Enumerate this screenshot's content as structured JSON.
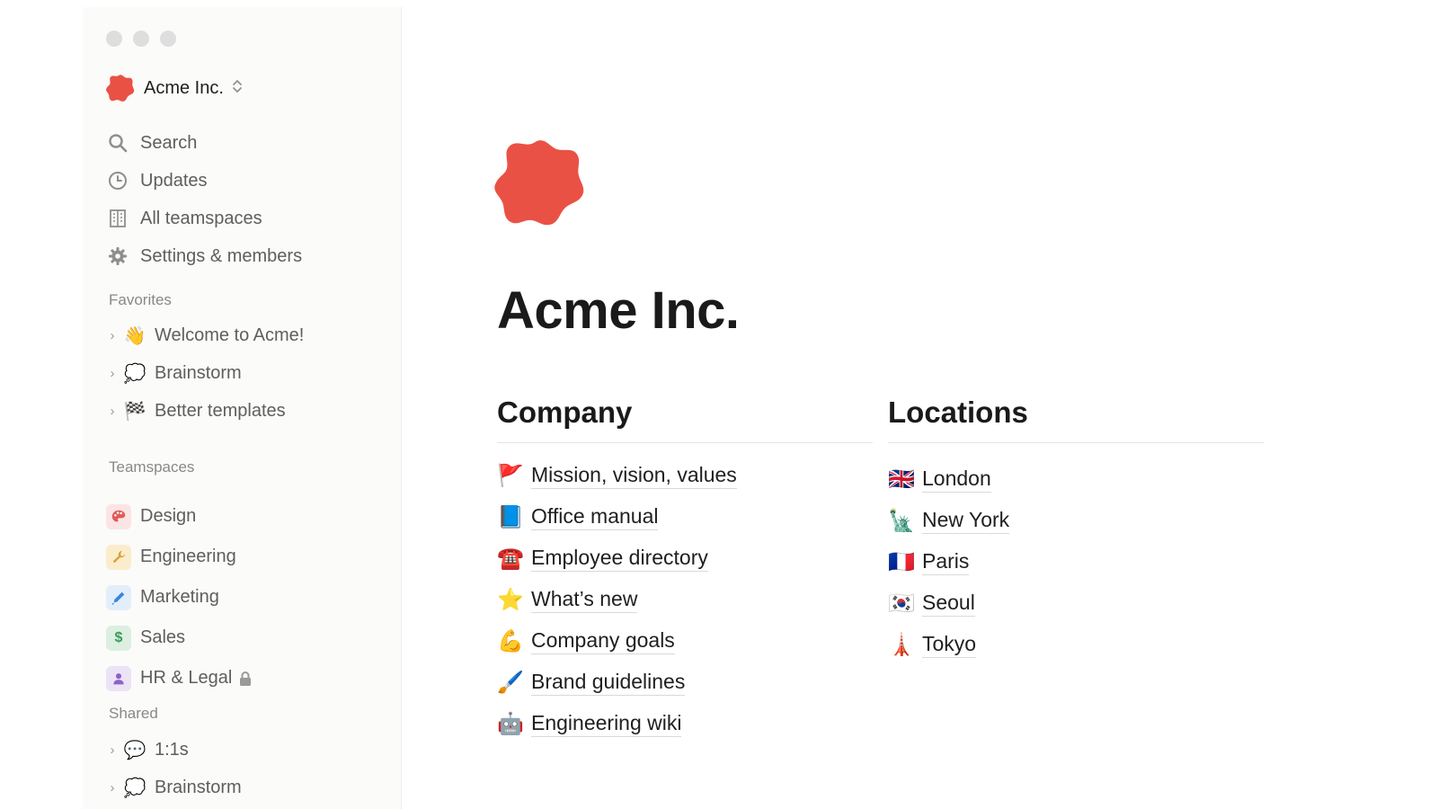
{
  "window": {
    "controls": [
      "close",
      "minimize",
      "maximize"
    ]
  },
  "workspace": {
    "name": "Acme Inc.",
    "logo_color": "#ea5145"
  },
  "sidebar": {
    "nav": [
      {
        "label": "Search",
        "icon": "search-icon"
      },
      {
        "label": "Updates",
        "icon": "clock-icon"
      },
      {
        "label": "All teamspaces",
        "icon": "building-icon"
      },
      {
        "label": "Settings & members",
        "icon": "gear-icon"
      }
    ],
    "favorites": {
      "label": "Favorites",
      "items": [
        {
          "emoji": "👋",
          "label": "Welcome to Acme!"
        },
        {
          "emoji": "💭",
          "label": "Brainstorm"
        },
        {
          "emoji": "🏁",
          "label": "Better templates"
        }
      ]
    },
    "teamspaces": {
      "label": "Teamspaces",
      "items": [
        {
          "icon": "palette-icon",
          "label": "Design",
          "badge_color": "#fbe4e4",
          "icon_color": "#e05a5a"
        },
        {
          "icon": "wrench-icon",
          "label": "Engineering",
          "badge_color": "#fbeccc",
          "icon_color": "#d9a43b"
        },
        {
          "icon": "pen-icon",
          "label": "Marketing",
          "badge_color": "#e3eefb",
          "icon_color": "#3d86d8"
        },
        {
          "icon": "dollar-icon",
          "label": "Sales",
          "badge_color": "#dcefe1",
          "icon_color": "#3a9a5b"
        },
        {
          "icon": "person-icon",
          "label": "HR & Legal",
          "badge_color": "#ece3f7",
          "icon_color": "#8a63c9",
          "locked": true
        }
      ]
    },
    "shared": {
      "label": "Shared",
      "items": [
        {
          "emoji": "💬",
          "label": "1:1s"
        },
        {
          "emoji": "💭",
          "label": "Brainstorm"
        }
      ]
    }
  },
  "main": {
    "title": "Acme Inc.",
    "company": {
      "heading": "Company",
      "links": [
        {
          "emoji": "🚩",
          "label": "Mission, vision, values"
        },
        {
          "emoji": "📘",
          "label": "Office manual"
        },
        {
          "emoji": "☎️",
          "label": "Employee directory"
        },
        {
          "emoji": "⭐",
          "label": "What’s new"
        },
        {
          "emoji": "💪",
          "label": "Company goals"
        },
        {
          "emoji": "🖌️",
          "label": "Brand guidelines"
        },
        {
          "emoji": "🤖",
          "label": "Engineering wiki"
        }
      ]
    },
    "locations": {
      "heading": "Locations",
      "links": [
        {
          "emoji": "🇬🇧",
          "label": "London"
        },
        {
          "emoji": "🗽",
          "label": "New York"
        },
        {
          "emoji": "🇫🇷",
          "label": "Paris"
        },
        {
          "emoji": "🇰🇷",
          "label": "Seoul"
        },
        {
          "emoji": "🗼",
          "label": "Tokyo"
        }
      ]
    }
  }
}
